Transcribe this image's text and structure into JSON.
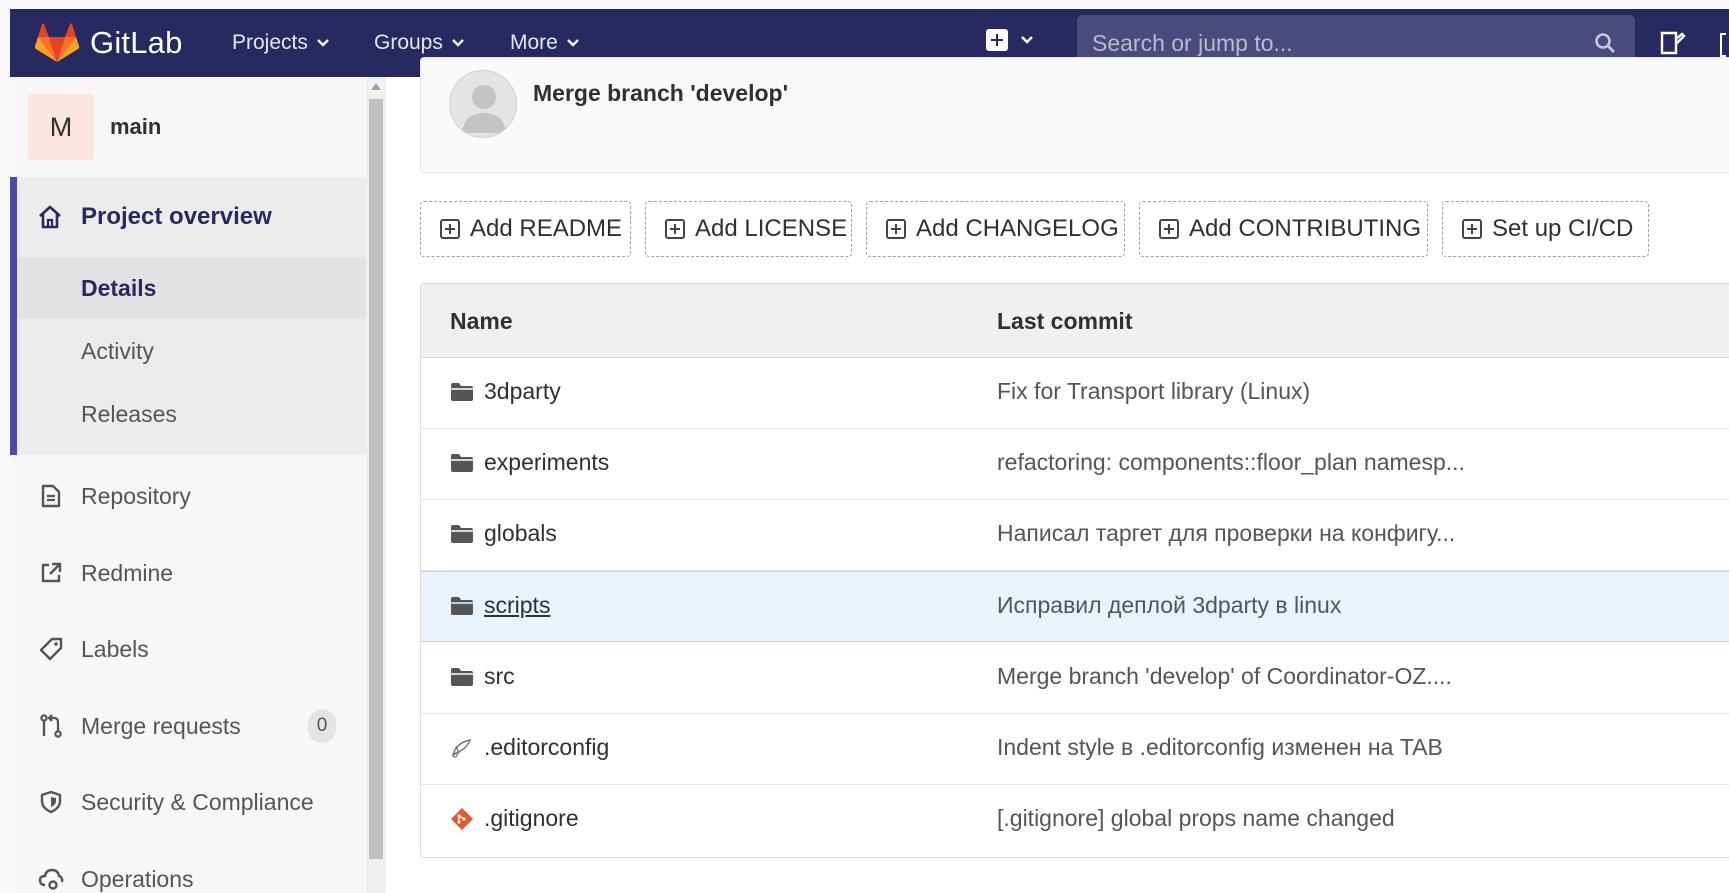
{
  "navbar": {
    "brand": "GitLab",
    "menus": [
      {
        "label": "Projects"
      },
      {
        "label": "Groups"
      },
      {
        "label": "More"
      }
    ],
    "search_placeholder": "Search or jump to..."
  },
  "sidebar": {
    "project_avatar_letter": "M",
    "project_name": "main",
    "overview": {
      "title": "Project overview",
      "items": [
        "Details",
        "Activity",
        "Releases"
      ],
      "active": "Details"
    },
    "items": [
      {
        "label": "Repository",
        "icon": "document-icon"
      },
      {
        "label": "Redmine",
        "icon": "external-link-icon"
      },
      {
        "label": "Labels",
        "icon": "label-icon"
      },
      {
        "label": "Merge requests",
        "icon": "merge-request-icon",
        "count": "0"
      },
      {
        "label": "Security & Compliance",
        "icon": "shield-icon"
      },
      {
        "label": "Operations",
        "icon": "cloud-gear-icon"
      }
    ]
  },
  "commit": {
    "title": "Merge branch 'develop'"
  },
  "quick_buttons": [
    "Add README",
    "Add LICENSE",
    "Add CHANGELOG",
    "Add CONTRIBUTING",
    "Set up CI/CD"
  ],
  "tree": {
    "columns": {
      "name": "Name",
      "last_commit": "Last commit"
    },
    "rows": [
      {
        "name": "3dparty",
        "type": "folder",
        "commit": "Fix for Transport library (Linux)"
      },
      {
        "name": "experiments",
        "type": "folder",
        "commit": "refactoring: components::floor_plan namesp..."
      },
      {
        "name": "globals",
        "type": "folder",
        "commit": "Написал таргет для проверки на конфигу..."
      },
      {
        "name": "scripts",
        "type": "folder",
        "commit": "Исправил деплой 3dparty в linux",
        "hovered": true
      },
      {
        "name": "src",
        "type": "folder",
        "commit": "Merge branch 'develop' of Coordinator-OZ...."
      },
      {
        "name": ".editorconfig",
        "type": "editorconfig",
        "commit": "Indent style в .editorconfig изменен на TAB"
      },
      {
        "name": ".gitignore",
        "type": "git",
        "commit": "[.gitignore] global props name changed"
      }
    ]
  },
  "colors": {
    "navbar_bg": "#292961",
    "accent": "#4b4ba3",
    "hover_row": "#e9f3fc"
  }
}
